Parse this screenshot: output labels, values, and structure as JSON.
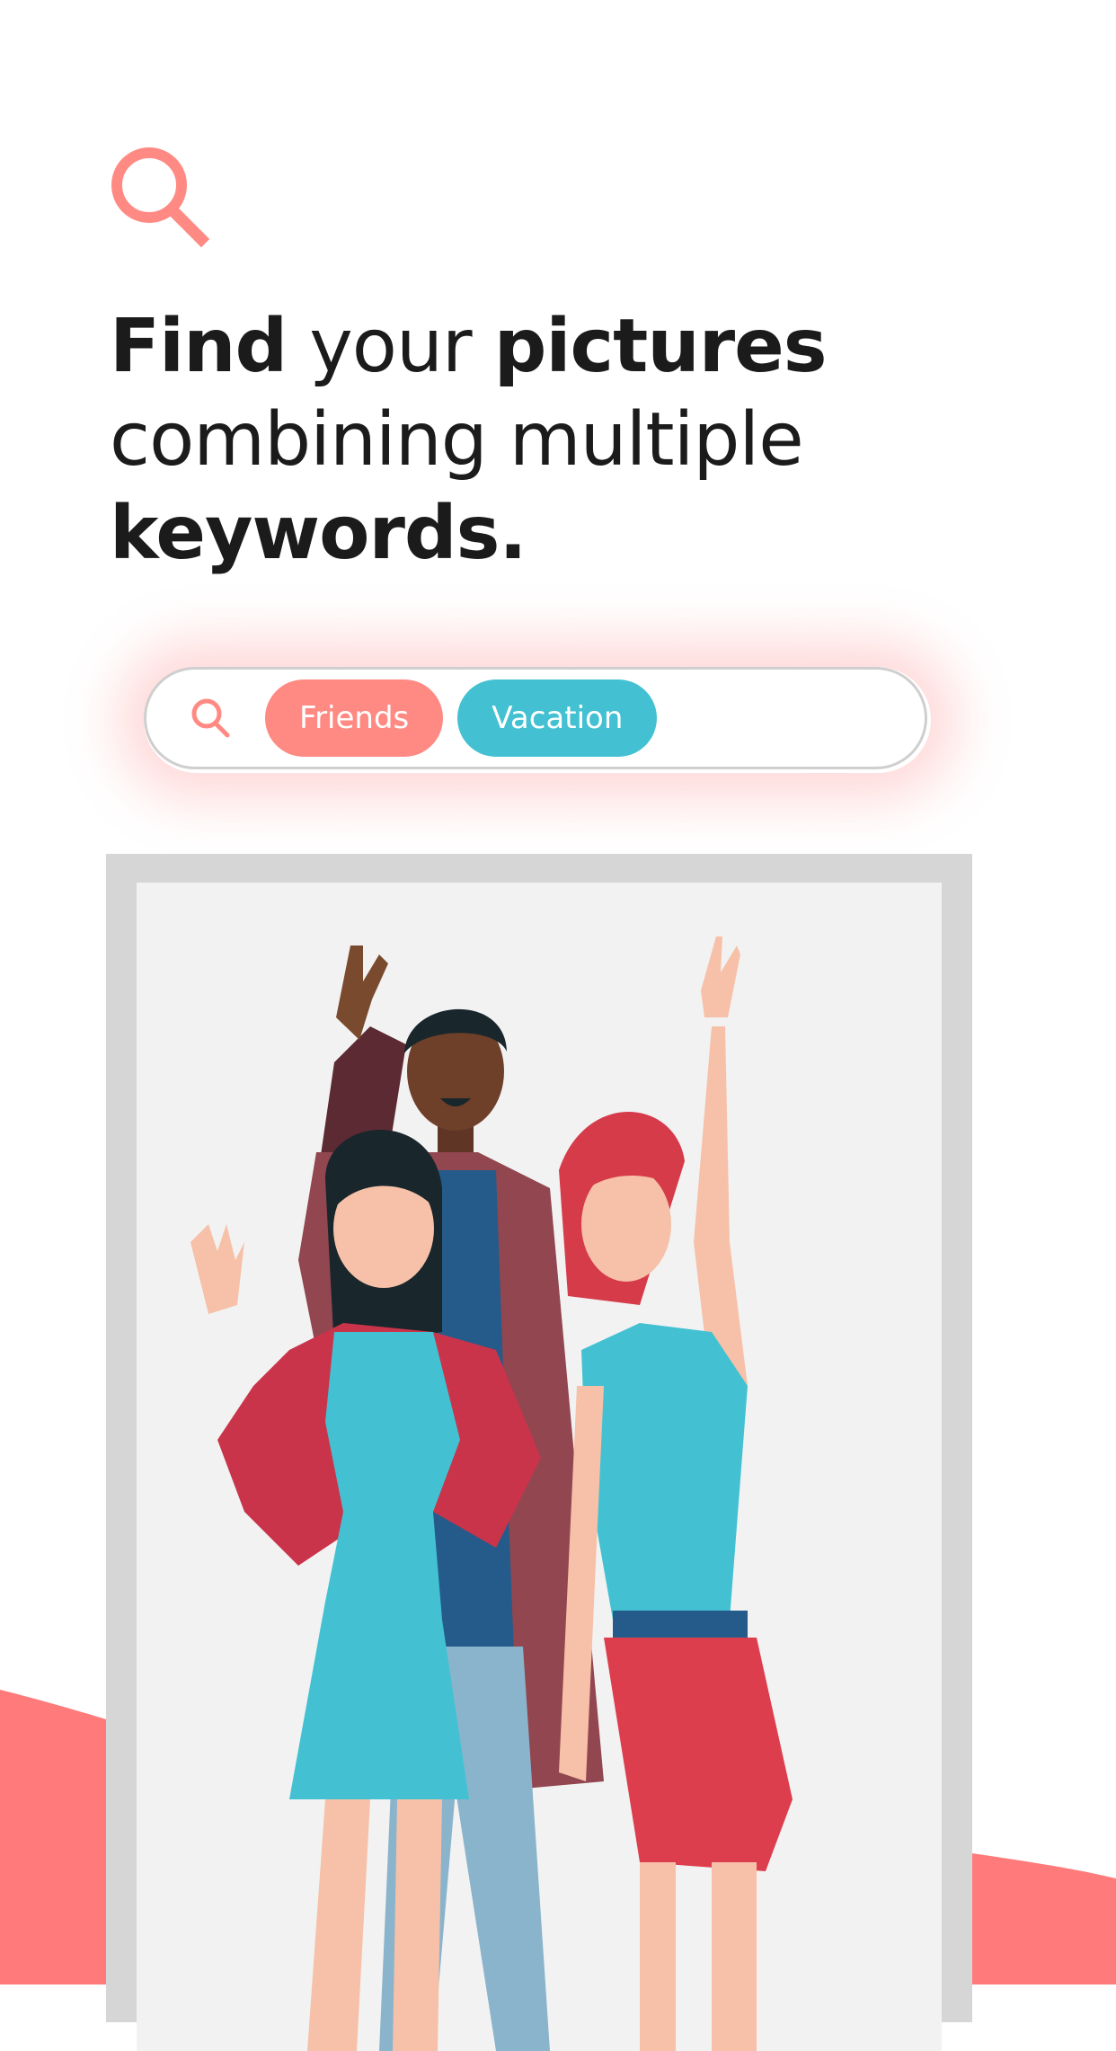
{
  "colors": {
    "accent": "#ff8a84",
    "teal": "#43c1d2",
    "wave": "#ff7b7b",
    "frame": "#d6d6d6",
    "text": "#1b1b1b"
  },
  "headline": {
    "w1": "Find",
    "w2": " your ",
    "w3": "pictures",
    "w4": "combining multiple",
    "w5": "keywords."
  },
  "search": {
    "icon": "search-icon",
    "chips": [
      {
        "label": "Friends",
        "color": "#ff8a84"
      },
      {
        "label": "Vacation",
        "color": "#43c1d2"
      }
    ]
  },
  "illustration": {
    "subject": "group of three friends waving"
  }
}
